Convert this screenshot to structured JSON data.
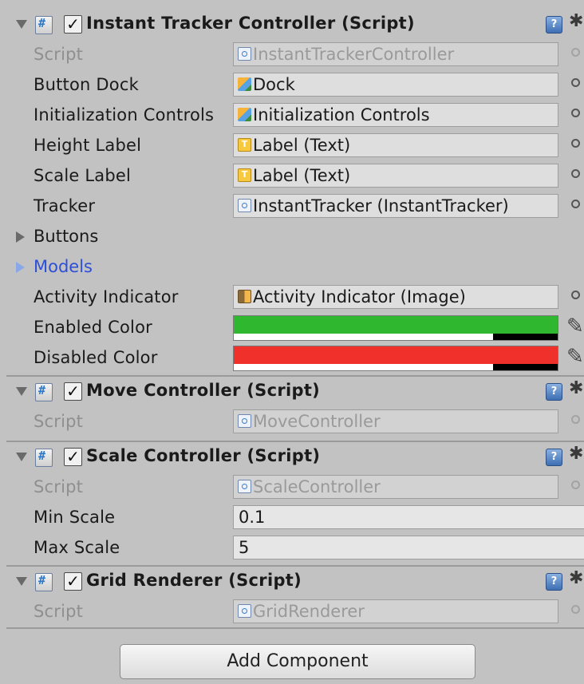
{
  "components": [
    {
      "title": "Instant Tracker Controller (Script)",
      "enabled": true,
      "fields": [
        {
          "label": "Script",
          "value": "InstantTrackerController",
          "icon": "script-icon",
          "dim": true
        },
        {
          "label": "Button Dock",
          "value": "Dock",
          "icon": "prefab-cube-icon"
        },
        {
          "label": "Initialization Controls",
          "value": "Initialization Controls",
          "icon": "prefab-cube-icon"
        },
        {
          "label": "Height Label",
          "value": "Label (Text)",
          "icon": "text-icon"
        },
        {
          "label": "Scale Label",
          "value": "Label (Text)",
          "icon": "text-icon"
        },
        {
          "label": "Tracker",
          "value": "InstantTracker (InstantTracker)",
          "icon": "script-icon"
        }
      ],
      "groups": [
        {
          "label": "Buttons",
          "highlighted": false
        },
        {
          "label": "Models",
          "highlighted": true
        }
      ],
      "extra_fields": [
        {
          "label": "Activity Indicator",
          "value": "Activity Indicator (Image)",
          "icon": "image-icon"
        }
      ],
      "colors": [
        {
          "label": "Enabled Color",
          "color": "#2fb82f",
          "alpha": 0.8
        },
        {
          "label": "Disabled Color",
          "color": "#f0302a",
          "alpha": 0.8
        }
      ]
    },
    {
      "title": "Move Controller (Script)",
      "enabled": true,
      "fields": [
        {
          "label": "Script",
          "value": "MoveController",
          "icon": "script-icon",
          "dim": true
        }
      ]
    },
    {
      "title": "Scale Controller (Script)",
      "enabled": true,
      "fields": [
        {
          "label": "Script",
          "value": "ScaleController",
          "icon": "script-icon",
          "dim": true
        },
        {
          "label": "Min Scale",
          "value": "0.1"
        },
        {
          "label": "Max Scale",
          "value": "5"
        }
      ]
    },
    {
      "title": "Grid Renderer (Script)",
      "enabled": true,
      "fields": [
        {
          "label": "Script",
          "value": "GridRenderer",
          "icon": "script-icon",
          "dim": true
        }
      ]
    }
  ],
  "add_component_label": "Add Component",
  "icons": {
    "help": "help-icon",
    "settings": "gear-icon",
    "picker": "object-picker-icon",
    "eyedropper": "eyedropper-icon"
  },
  "help_glyph": "?",
  "gear_glyph": "✱",
  "check_glyph": "✓"
}
